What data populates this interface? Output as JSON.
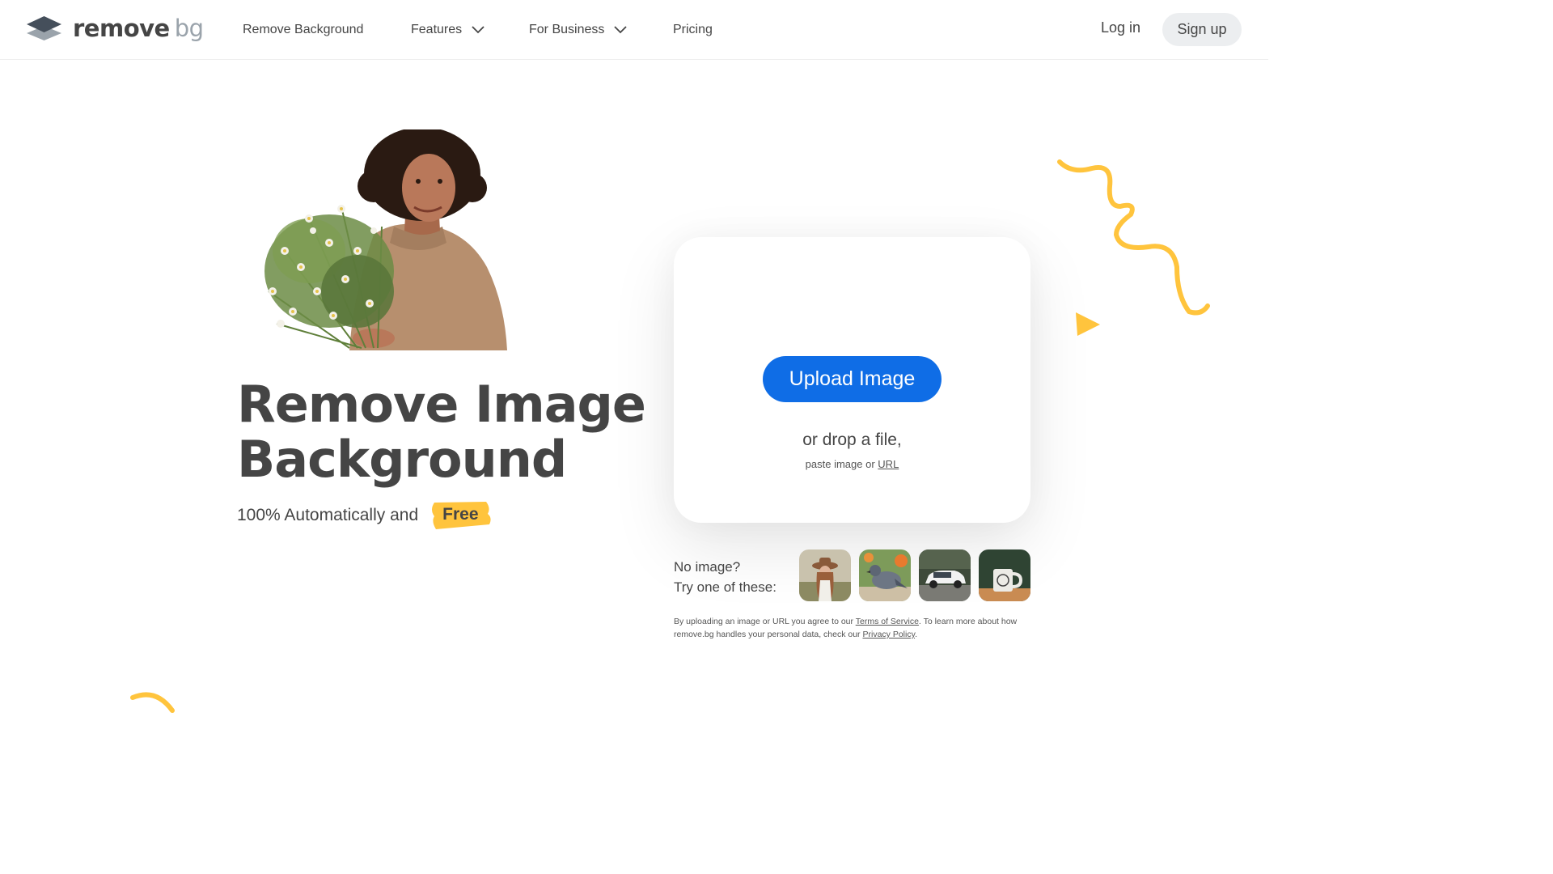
{
  "header": {
    "logo": {
      "word1": "remove",
      "word2": "bg"
    },
    "nav": [
      {
        "label": "Remove Background",
        "has_dropdown": false
      },
      {
        "label": "Features",
        "has_dropdown": true
      },
      {
        "label": "For Business",
        "has_dropdown": true
      },
      {
        "label": "Pricing",
        "has_dropdown": false
      }
    ],
    "login_label": "Log in",
    "signup_label": "Sign up"
  },
  "hero": {
    "title_line1": "Remove Image",
    "title_line2": "Background",
    "subtitle": "100% Automatically and",
    "highlight": "Free"
  },
  "upload": {
    "button_label": "Upload Image",
    "drop_text": "or drop a file,",
    "paste_text": "paste image or",
    "url_link": "URL"
  },
  "samples": {
    "line1": "No image?",
    "line2": "Try one of these:",
    "thumbnails": [
      "woman-with-hat",
      "pigeon",
      "white-car",
      "coffee-mug"
    ]
  },
  "legal": {
    "part1": "By uploading an image or URL you agree to our",
    "tos_link": "Terms of Service",
    "part2": ". To learn more about how remove.bg handles your personal data, check our",
    "privacy_link": "Privacy Policy",
    "part3": "."
  },
  "colors": {
    "accent_blue": "#0f6de6",
    "accent_yellow": "#ffc43d",
    "text": "#454545"
  }
}
